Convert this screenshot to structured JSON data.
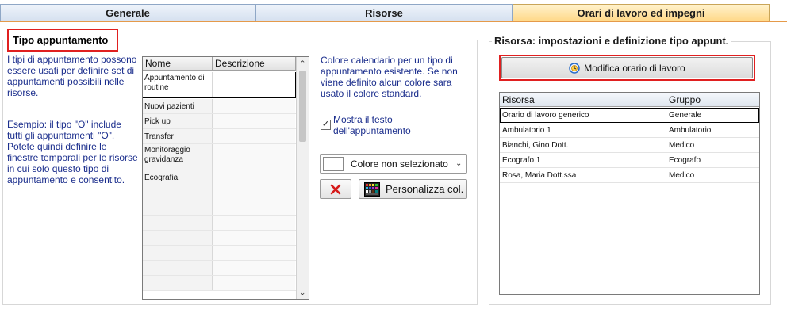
{
  "tabs": [
    {
      "label": "Generale",
      "active": false
    },
    {
      "label": "Risorse",
      "active": false
    },
    {
      "label": "Orari di lavoro ed impegni",
      "active": true
    }
  ],
  "left_section": {
    "title": "Tipo appuntamento",
    "description_1": "I tipi di appuntamento possono essere usati per definire set di appuntamenti possibili nelle risorse.",
    "description_2": "Esempio: il tipo \"O\" include tutti gli appuntamenti \"O\". Potete quindi definire le finestre temporali per le risorse in cui solo questo tipo di appuntamento e consentito.",
    "grid": {
      "columns": [
        "Nome",
        "Descrizione"
      ],
      "rows": [
        {
          "nome": "Appuntamento di routine",
          "descrizione": "",
          "selected": true
        },
        {
          "nome": "Nuovi pazienti",
          "descrizione": ""
        },
        {
          "nome": "Pick up",
          "descrizione": ""
        },
        {
          "nome": "Transfer",
          "descrizione": ""
        },
        {
          "nome": "Monitoraggio gravidanza",
          "descrizione": ""
        },
        {
          "nome": "Ecografia",
          "descrizione": ""
        }
      ]
    },
    "color_info": "Colore calendario per un tipo di appuntamento esistente. Se non viene definito alcun colore sara usato il colore standard.",
    "show_text_checkbox": {
      "label": "Mostra il testo dell'appuntamento",
      "checked": true
    },
    "color_combo": {
      "value": "Colore non selezionato"
    },
    "delete_button_icon": "red-x-icon",
    "customize_button": {
      "label": "Personalizza col.",
      "icon": "color-palette-icon"
    }
  },
  "right_section": {
    "title": "Risorsa: impostazioni e definizione tipo appunt.",
    "modify_button": {
      "label": "Modifica orario di lavoro",
      "icon": "clock-icon"
    },
    "grid": {
      "columns": [
        "Risorsa",
        "Gruppo"
      ],
      "rows": [
        {
          "risorsa": "Orario di lavoro generico",
          "gruppo": "Generale",
          "selected": true
        },
        {
          "risorsa": "Ambulatorio 1",
          "gruppo": "Ambulatorio"
        },
        {
          "risorsa": "Bianchi, Gino Dott.",
          "gruppo": "Medico"
        },
        {
          "risorsa": "Ecografo 1",
          "gruppo": "Ecografo"
        },
        {
          "risorsa": "Rosa, Maria Dott.ssa",
          "gruppo": "Medico"
        }
      ]
    }
  },
  "colors": {
    "active_tab": "#ffd98a",
    "highlight_border": "#e02020",
    "description_text": "#1a2d8c"
  }
}
